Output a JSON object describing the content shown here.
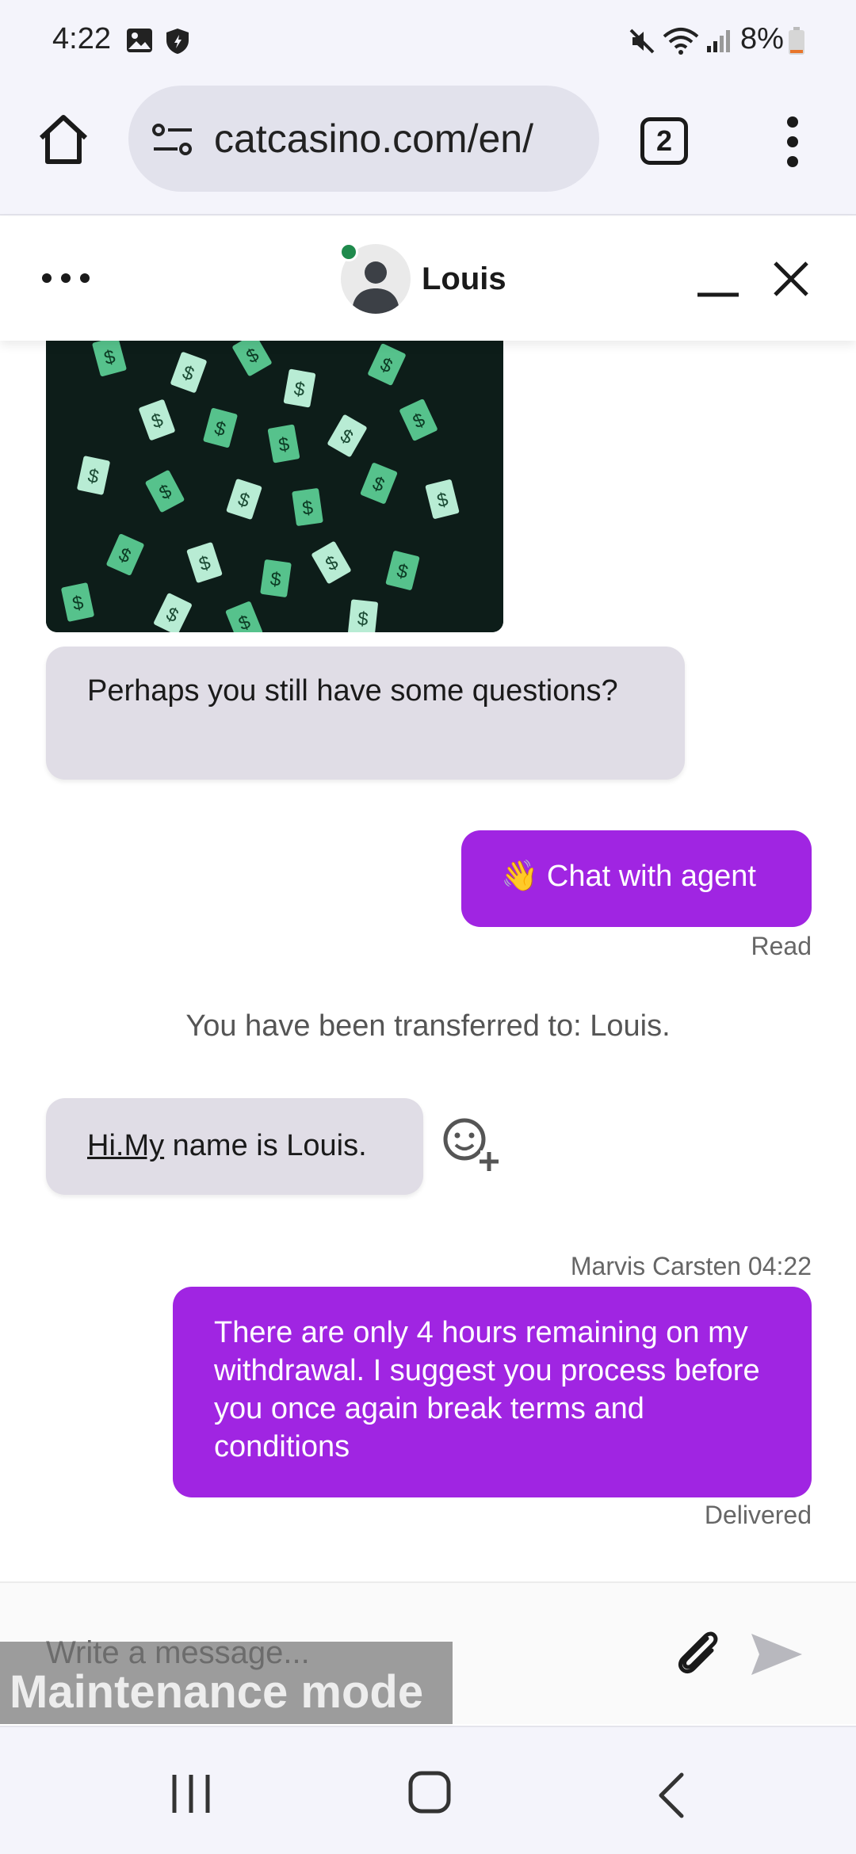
{
  "status_bar": {
    "time": "4:22",
    "battery": "8%",
    "icons": [
      "image-icon",
      "shield-icon",
      "mute-icon",
      "wifi-icon",
      "signal-icon",
      "battery-icon"
    ]
  },
  "browser": {
    "url": "catcasino.com/en/",
    "tab_count": "2",
    "icons": [
      "home-icon",
      "site-settings-icon",
      "more-vert-icon"
    ]
  },
  "chat_header": {
    "agent_name": "Louis",
    "online_color": "#1f8a4c"
  },
  "messages": {
    "bot_question": "Perhaps you still have some questions?",
    "chat_with_agent": "Chat with agent",
    "chat_with_agent_emoji": "👋",
    "read_status": "Read",
    "transfer_notice": "You have been transferred to: Louis.",
    "agent_greeting_link": "Hi.My",
    "agent_greeting_rest": " name is Louis.",
    "user_meta": "Marvis Carsten 04:22",
    "user_message": "There are only 4 hours remaining on my withdrawal. I suggest you process before you once again break terms and conditions",
    "delivered_status": "Delivered"
  },
  "composer": {
    "placeholder": "Write a message...",
    "overlay": "Maintenance mode"
  },
  "colors": {
    "accent": "#a025e2",
    "incoming_bubble": "#e0dde6",
    "online": "#1f8a4c"
  }
}
